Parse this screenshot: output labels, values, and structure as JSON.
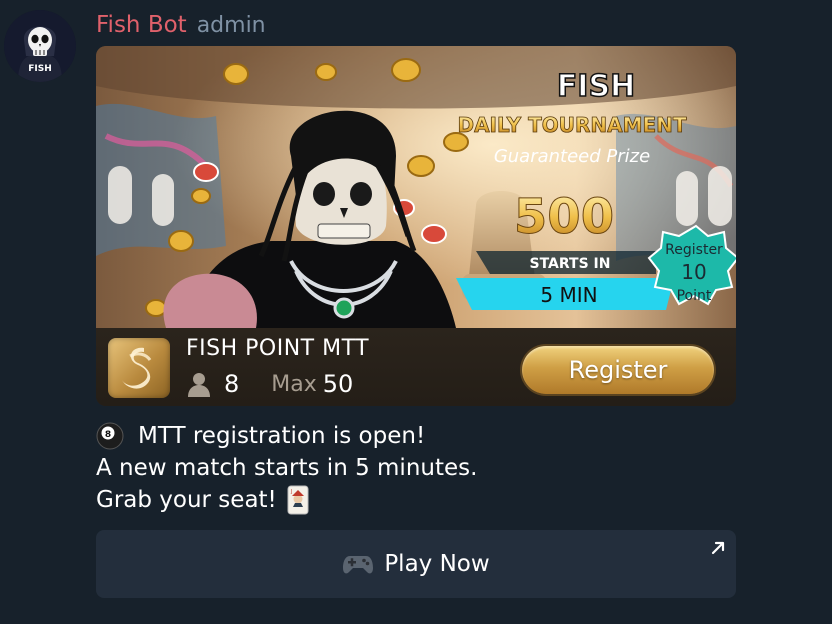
{
  "message": {
    "sender_name": "Fish Bot",
    "sender_role": "admin",
    "avatar": {
      "text": "FISH",
      "icon": "skull-icon"
    },
    "card": {
      "banner": {
        "logo_text": "FISH",
        "title": "DAILY TOURNAMENT",
        "subtitle": "Guaranteed Prize",
        "prize": "500",
        "starts_label": "STARTS IN",
        "starts_value": "5 MIN",
        "badge_top": "Register",
        "badge_value": "10",
        "badge_bottom": "Point"
      },
      "title": "FISH POINT MTT",
      "players": "8",
      "max_label": "Max",
      "max_value": "50",
      "register_label": "Register"
    },
    "text_lines": [
      "MTT registration is open!",
      "A new match starts in 5 minutes.",
      "Grab your seat!"
    ],
    "play_button_label": "Play Now"
  },
  "colors": {
    "background": "#17212b",
    "sender": "#e0616b",
    "role": "#7f91a4",
    "button_bg": "#232e3c",
    "gold": "#d9a94b",
    "cyan_banner": "#26d4ee"
  }
}
